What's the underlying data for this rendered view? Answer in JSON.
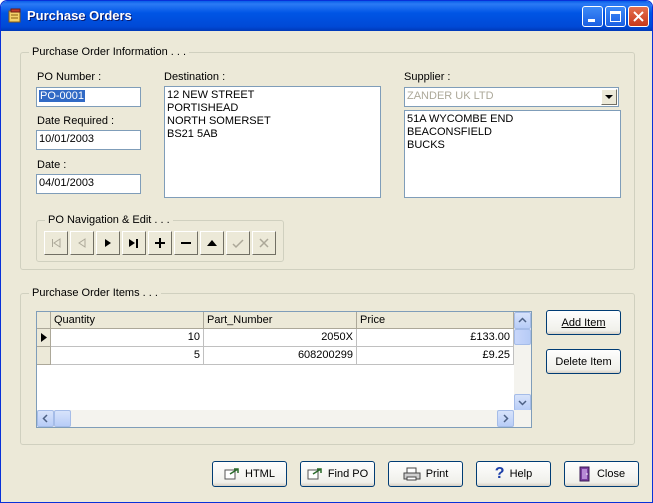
{
  "window": {
    "title": "Purchase Orders"
  },
  "po_info": {
    "group_label": "Purchase Order Information . . .",
    "po_number_label": "PO Number :",
    "po_number": "PO-0001",
    "date_required_label": "Date Required :",
    "date_required": "10/01/2003",
    "date_label": "Date :",
    "date": "04/01/2003",
    "destination_label": "Destination :",
    "destination_lines": [
      "12 NEW STREET",
      "PORTISHEAD",
      "NORTH SOMERSET",
      "BS21 5AB"
    ],
    "supplier_label": "Supplier :",
    "supplier": "ZANDER UK LTD",
    "supplier_lines": [
      "51A WYCOMBE END",
      "BEACONSFIELD",
      "BUCKS"
    ],
    "nav_label": "PO Navigation & Edit . . ."
  },
  "items": {
    "group_label": "Purchase Order Items . . .",
    "columns": [
      "Quantity",
      "Part_Number",
      "Price"
    ],
    "rows": [
      [
        "10",
        "2050X",
        "£133.00"
      ],
      [
        "5",
        "608200299",
        "£9.25"
      ]
    ],
    "add_item": "Add Item",
    "delete_item": "Delete Item"
  },
  "buttons": {
    "html": "HTML",
    "find_po": "Find PO",
    "print": "Print",
    "help": "Help",
    "close": "Close"
  },
  "icons": {
    "app": "order-book-icon",
    "nav": [
      "first-record-icon",
      "prior-record-icon",
      "next-record-icon",
      "last-record-icon",
      "insert-icon",
      "delete-icon",
      "edit-icon",
      "post-icon",
      "cancel-icon"
    ]
  },
  "colors": {
    "title_bar": "#0055e5",
    "selection": "#316ac5",
    "face": "#ece9d8"
  }
}
